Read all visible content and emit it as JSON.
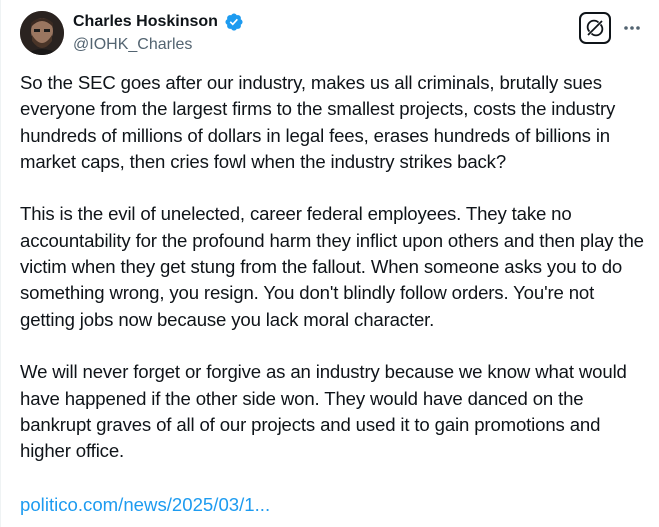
{
  "author": {
    "name": "Charles Hoskinson",
    "handle": "@IOHK_Charles",
    "avatar_icon": "profile-photo",
    "verified_icon": "verified-badge-icon",
    "verified_color": "#1d9bf0"
  },
  "actions": {
    "grok_icon": "grok-icon",
    "more_icon": "more-options-icon"
  },
  "tweet": {
    "paragraphs": [
      "So the SEC goes after our industry, makes us all criminals, brutally sues everyone from the largest firms to the smallest projects, costs the industry hundreds of millions of dollars in legal fees, erases hundreds of billions in market caps, then cries fowl when the industry strikes back?",
      "This is the evil of unelected, career federal employees. They take no accountability for the profound harm they inflict upon others and then play the victim when they get stung from the fallout. When someone asks you to do something wrong, you resign. You don't blindly follow orders. You're not getting jobs now because you lack moral character.",
      "We will never forget or forgive as an industry because we know what would have happened if the other side won. They would have danced on the bankrupt graves of all of our projects and used it to gain promotions and higher office."
    ],
    "link_text": "politico.com/news/2025/03/1...",
    "link_color": "#1d9bf0"
  }
}
